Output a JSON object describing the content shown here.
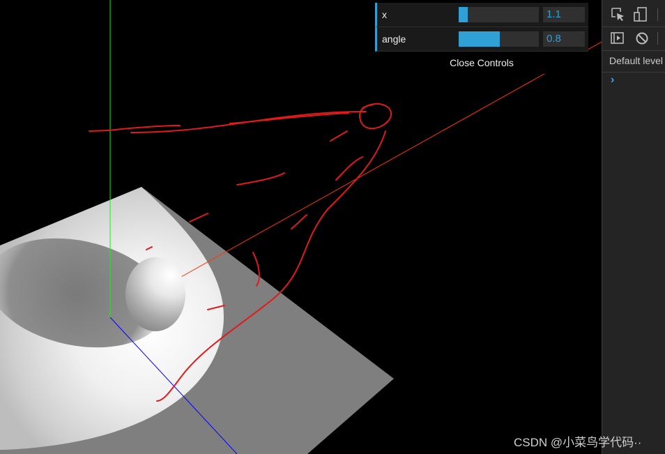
{
  "gui": {
    "controls": [
      {
        "label": "x",
        "value": "1.1",
        "level": 0.11
      },
      {
        "label": "angle",
        "value": "0.8",
        "level": 0.51
      }
    ],
    "close_label": "Close Controls",
    "accent_color": "#2fa1d6"
  },
  "devtools": {
    "toolbar_icons": [
      "inspect-element-icon",
      "device-toolbar-icon",
      "sidebar-toggle-icon",
      "clear-console-icon"
    ],
    "level_filter": "Default level",
    "prompt_symbol": "›"
  },
  "scene": {
    "background_color": "#000000",
    "y_axis_color": "#00ff00",
    "z_axis_color": "#0000ff",
    "light_ray_color": "#ff3300",
    "annotation_color": "#e01b1b"
  },
  "watermark": "CSDN @小菜鸟学代码··"
}
